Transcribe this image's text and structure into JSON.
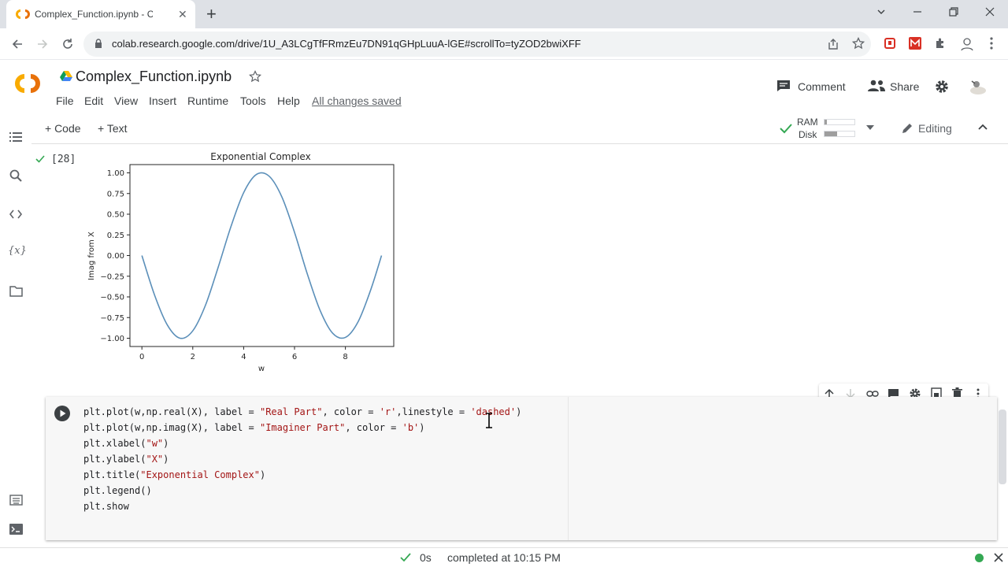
{
  "browser": {
    "tab_title": "Complex_Function.ipynb - Colab",
    "url": "colab.research.google.com/drive/1U_A3LCgTfFRmzEu7DN91qGHpLuuA-lGE#scrollTo=tyZOD2bwiXFF"
  },
  "colab": {
    "logo_text": "CO",
    "notebook_title": "Complex_Function.ipynb",
    "menu": [
      "File",
      "Edit",
      "View",
      "Insert",
      "Runtime",
      "Tools",
      "Help"
    ],
    "saved_status": "All changes saved",
    "comment_label": "Comment",
    "share_label": "Share"
  },
  "cell_toolbar": {
    "add_code": "+ Code",
    "add_text": "+ Text",
    "ram_label": "RAM",
    "disk_label": "Disk",
    "editing_label": "Editing"
  },
  "output": {
    "exec_count": "[28]"
  },
  "chart_data": {
    "type": "line",
    "title": "Exponential Complex",
    "xlabel": "w",
    "ylabel": "Imag from X",
    "xlim": [
      -0.47,
      9.9
    ],
    "ylim": [
      -1.1,
      1.1
    ],
    "xticks": [
      0,
      2,
      4,
      6,
      8
    ],
    "xtick_labels": [
      "0",
      "2",
      "4",
      "6",
      "8"
    ],
    "yticks": [
      1.0,
      0.75,
      0.5,
      0.25,
      0.0,
      -0.25,
      -0.5,
      -0.75,
      -1.0
    ],
    "ytick_labels": [
      "1.00",
      "0.75",
      "0.50",
      "0.25",
      "0.00",
      "−0.25",
      "−0.50",
      "−0.75",
      "−1.00"
    ],
    "grid": false,
    "series": [
      {
        "color": "#5b8fb9",
        "x": [
          0.0,
          0.5,
          1.0,
          1.5,
          2.0,
          2.5,
          3.0,
          3.5,
          4.0,
          4.5,
          5.0,
          5.5,
          6.0,
          6.5,
          7.0,
          7.5,
          8.0,
          8.5,
          9.0,
          9.42
        ],
        "y": [
          0.0,
          -0.48,
          -0.84,
          -1.0,
          -0.91,
          -0.6,
          -0.14,
          0.35,
          0.76,
          0.98,
          0.96,
          0.71,
          0.28,
          -0.22,
          -0.66,
          -0.94,
          -0.99,
          -0.8,
          -0.41,
          0.0
        ]
      }
    ]
  },
  "code": {
    "lines": [
      [
        "plt.plot(w,np.real(X), label = ",
        "\"Real Part\"",
        ", color = ",
        "'r'",
        ",linestyle = ",
        "'dashed'",
        ")"
      ],
      [
        "plt.plot(w,np.imag(X), label = ",
        "\"Imaginer Part\"",
        ", color = ",
        "'b'",
        ")"
      ],
      [
        "plt.xlabel(",
        "\"w\"",
        ")"
      ],
      [
        "plt.ylabel(",
        "\"X\"",
        ")"
      ],
      [
        "plt.title(",
        "\"Exponential Complex\"",
        ")"
      ],
      [
        "plt.legend()"
      ],
      [
        "plt.show"
      ]
    ]
  },
  "status": {
    "duration": "0s",
    "completed_text": "completed at 10:15 PM"
  },
  "colors": {
    "colab_orange": "#f9ab00",
    "check_green": "#34a853",
    "tab_bar": "#dee1e6"
  }
}
